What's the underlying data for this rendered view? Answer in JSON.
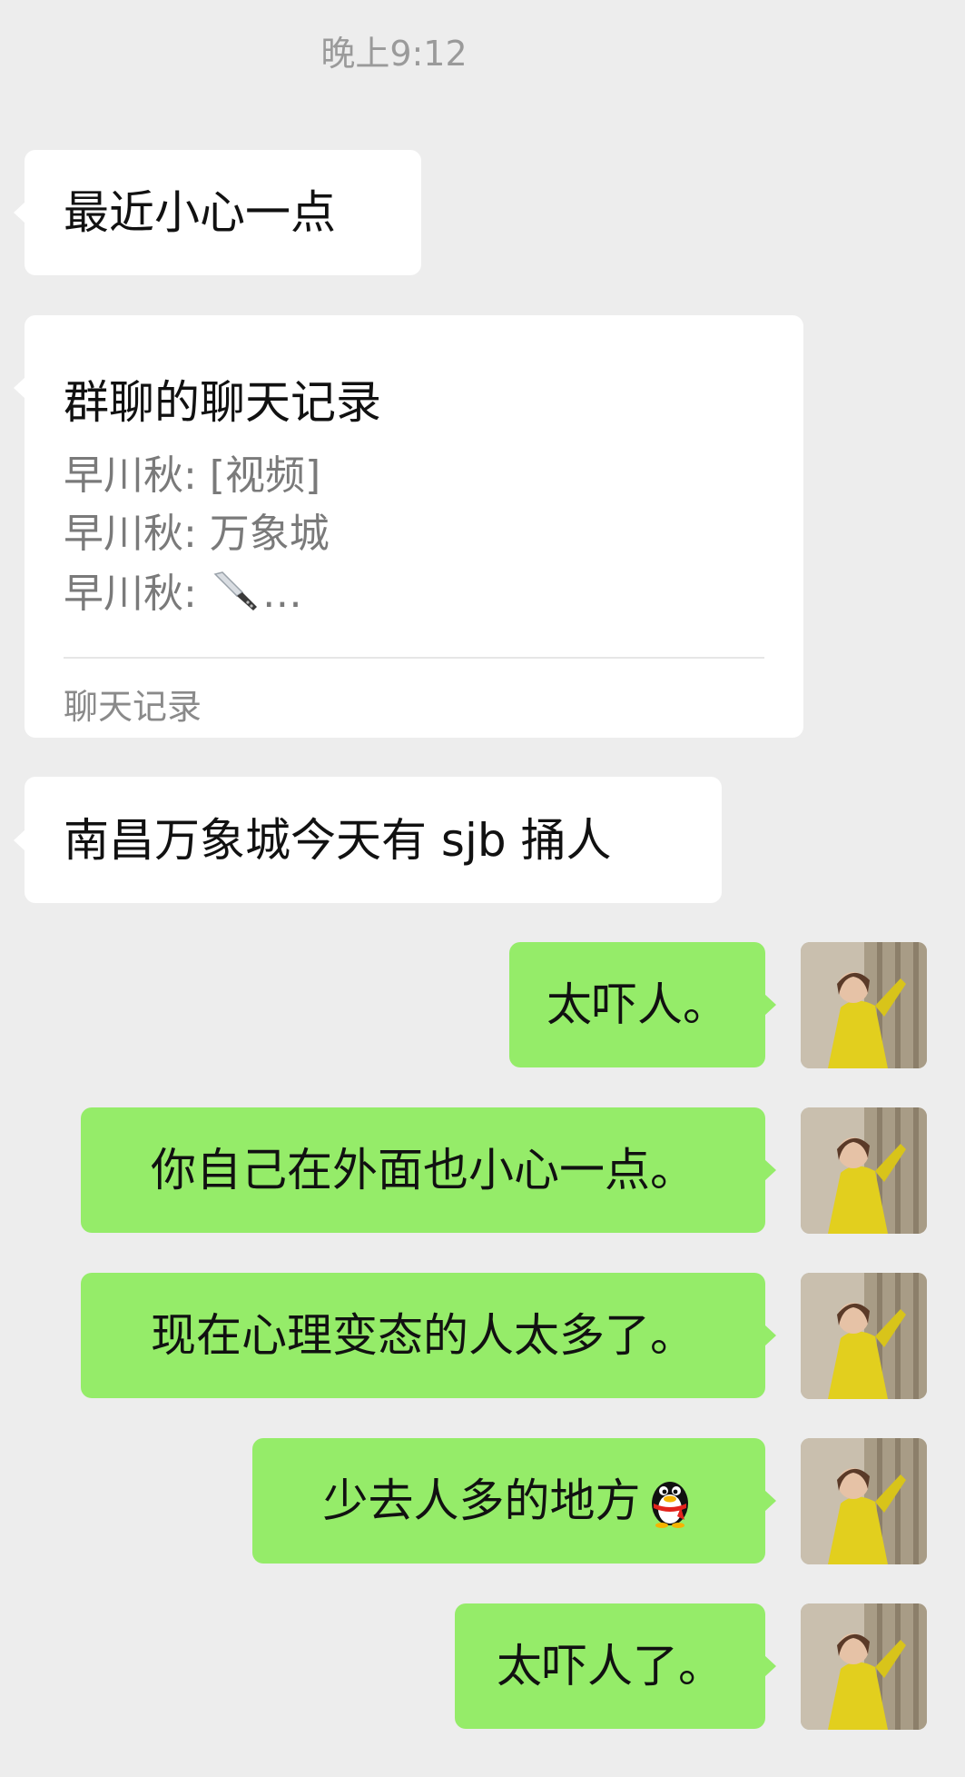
{
  "time": "晚上9:12",
  "incoming": {
    "msg1": "最近小心一点",
    "card": {
      "title": "群聊的聊天记录",
      "lines": [
        "早川秋: [视频]",
        "早川秋: 万象城",
        "早川秋: "
      ],
      "line3_suffix": "…",
      "line3_emoji": "knife-emoji",
      "footer": "聊天记录"
    },
    "msg2": "南昌万象城今天有 sjb 捅人"
  },
  "outgoing": [
    {
      "text": "太吓人。"
    },
    {
      "text": "你自己在外面也小心一点。"
    },
    {
      "text": "现在心理变态的人太多了。"
    },
    {
      "text": "少去人多的地方",
      "emoji": "qq-penguin-emoji"
    },
    {
      "text": "太吓人了。"
    }
  ],
  "colors": {
    "background": "#ededed",
    "incoming_bubble": "#ffffff",
    "outgoing_bubble": "#95ec69"
  },
  "avatar": "avatar-woman-in-yellow-coat"
}
